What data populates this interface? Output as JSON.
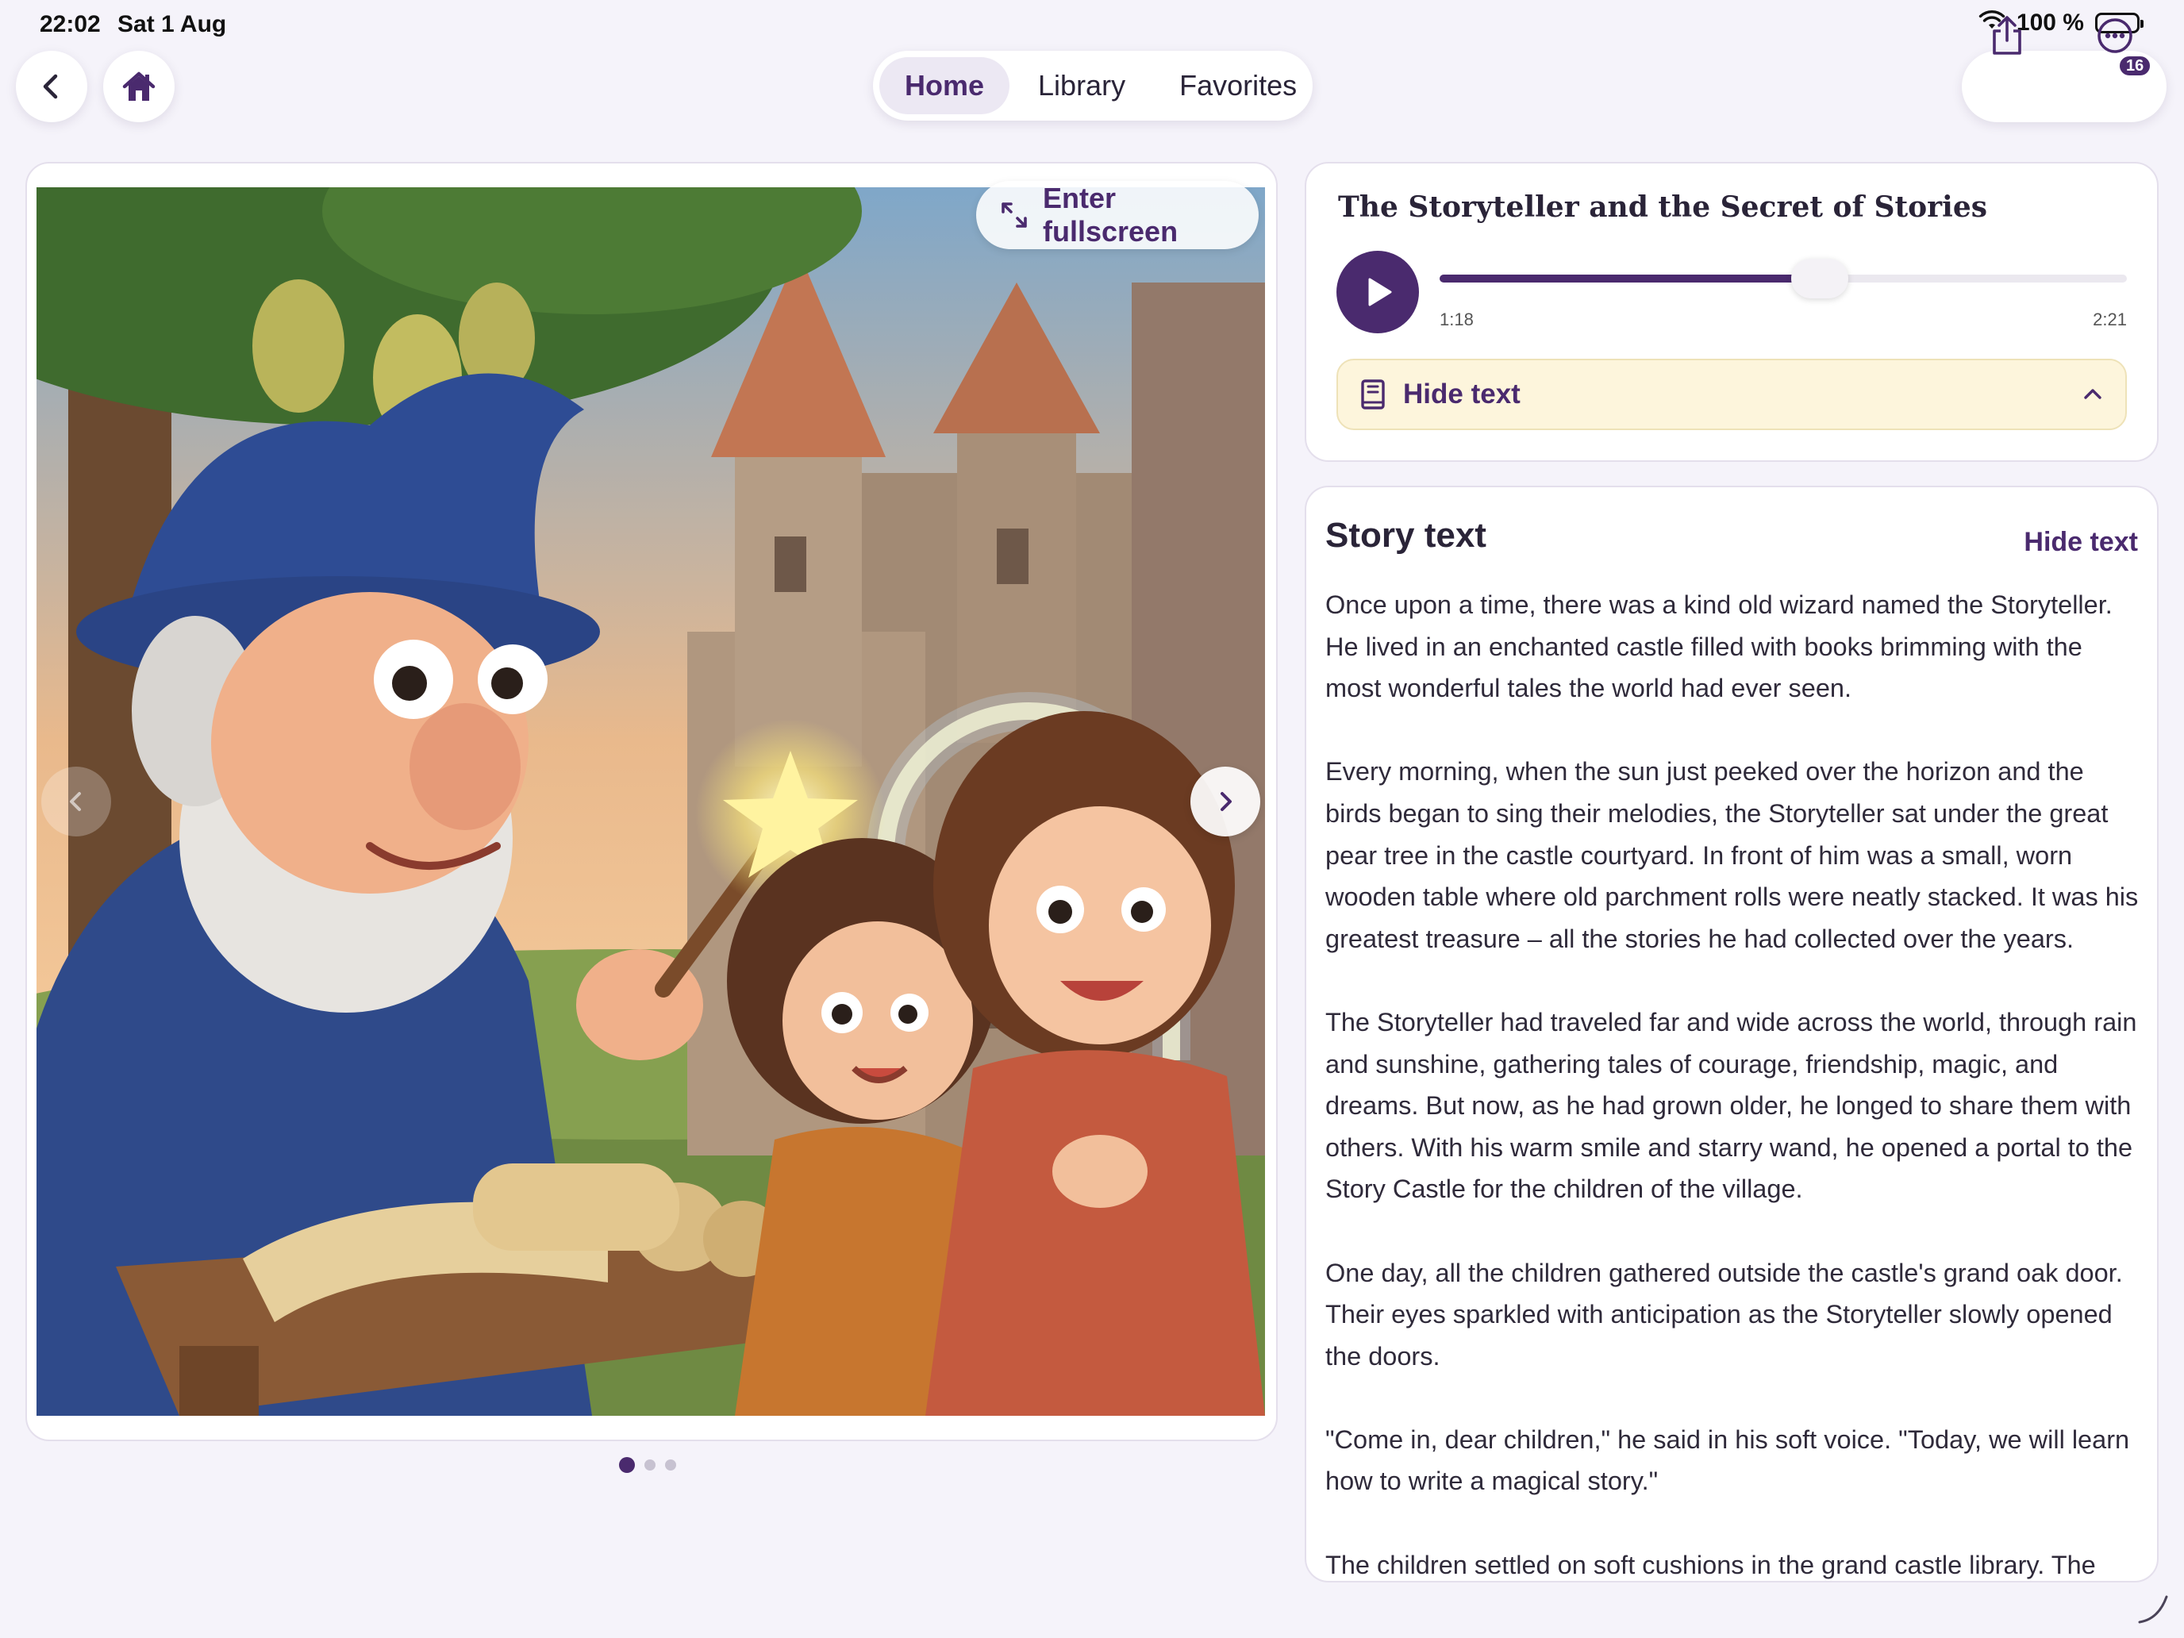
{
  "status_bar": {
    "time": "22:02",
    "date": "Sat 1 Aug",
    "battery_label": "100 %",
    "battery_level": 1.0
  },
  "nav": {
    "back_icon": "chevron-left-icon",
    "home_icon": "home-icon",
    "tabs": [
      {
        "label": "Home",
        "active": true
      },
      {
        "label": "Library",
        "active": false
      },
      {
        "label": "Favorites",
        "active": false
      }
    ],
    "share_icon": "share-icon",
    "more_icon": "more-icon",
    "notification_count": "16"
  },
  "viewer": {
    "fullscreen_label": "Enter fullscreen",
    "prev_icon": "chevron-left-icon",
    "next_icon": "chevron-right-icon",
    "page_count": 3,
    "current_page": 1
  },
  "player": {
    "title": "The Storyteller and the Secret of Stories",
    "elapsed": "1:18",
    "duration": "2:21",
    "progress": 0.553,
    "toggle_label": "Hide text"
  },
  "story": {
    "heading": "Story text",
    "hide_link": "Hide text",
    "paragraphs": [
      "Once upon a time, there was a kind old wizard named the Storyteller. He lived in an enchanted castle filled with books brimming with the most wonderful tales the world had ever seen.",
      "Every morning, when the sun just peeked over the horizon and the birds began to sing their melodies, the Storyteller sat under the great pear tree in the castle courtyard. In front of him was a small, worn wooden table where old parchment rolls were neatly stacked. It was his greatest treasure – all the stories he had collected over the years.",
      "The Storyteller had traveled far and wide across the world, through rain and sunshine, gathering tales of courage, friendship, magic, and dreams. But now, as he had grown older, he longed to share them with others. With his warm smile and starry wand, he opened a portal to the Story Castle for the children of the village.",
      "One day, all the children gathered outside the castle's grand oak door. Their eyes sparkled with anticipation as the Storyteller slowly opened the doors.",
      "\"Come in, dear children,\" he said in his soft voice. \"Today, we will learn how to write a magical story.\"",
      "The children settled on soft cushions in the grand castle library. The"
    ]
  },
  "colors": {
    "accent": "#4a2a6e",
    "background": "#f5f3fa",
    "hide_bar": "#fdf5dc"
  }
}
